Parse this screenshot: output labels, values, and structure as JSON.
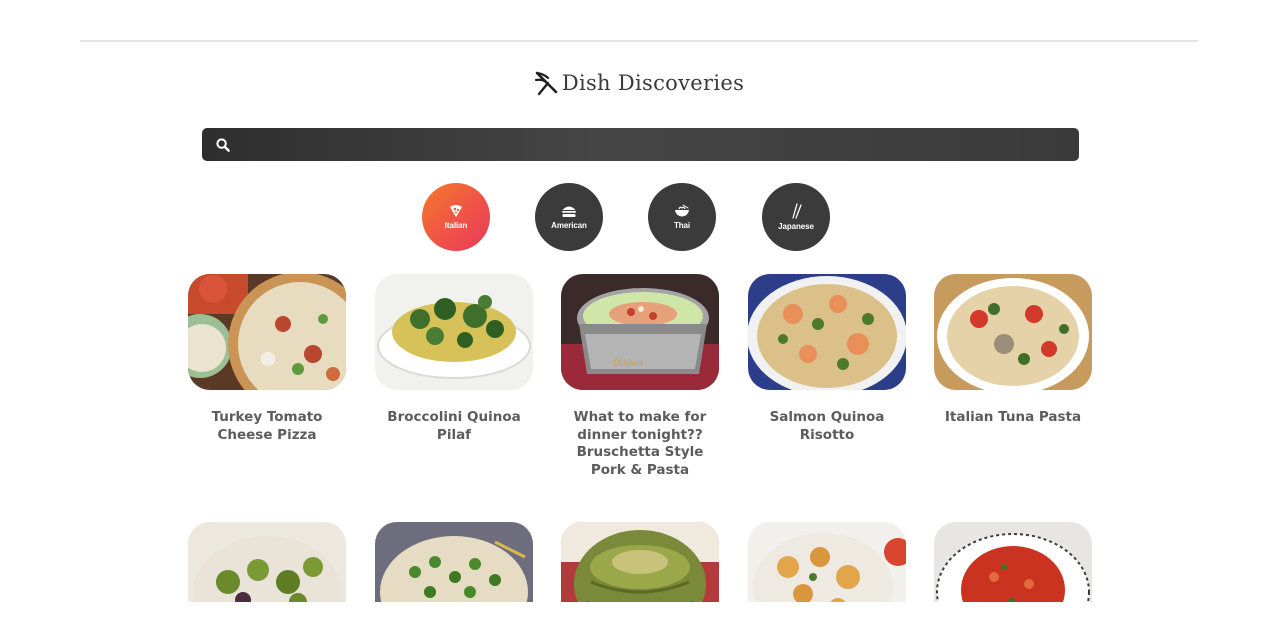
{
  "site": {
    "name": "Dish Discoveries"
  },
  "search": {
    "placeholder": "",
    "value": "",
    "icon": "search-icon"
  },
  "categories": [
    {
      "label": "Italian",
      "icon": "pizza-icon",
      "active": true
    },
    {
      "label": "American",
      "icon": "burger-icon",
      "active": false
    },
    {
      "label": "Thai",
      "icon": "noodle-bowl-icon",
      "active": false
    },
    {
      "label": "Japanese",
      "icon": "chopsticks-icon",
      "active": false
    }
  ],
  "colors": {
    "active_gradient_start": "#f47a2a",
    "active_gradient_end": "#e63b5b",
    "inactive_circle": "#3b3b3b",
    "search_bar": "#3a3a3a",
    "title_text": "#5c5c5c"
  },
  "recipes": [
    {
      "title": "Turkey Tomato Cheese Pizza"
    },
    {
      "title": "Broccolini Quinoa Pilaf"
    },
    {
      "title": "What to make for dinner tonight?? Bruschetta Style Pork & Pasta"
    },
    {
      "title": "Salmon Quinoa Risotto"
    },
    {
      "title": "Italian Tuna Pasta"
    },
    {
      "title": ""
    },
    {
      "title": ""
    },
    {
      "title": ""
    },
    {
      "title": ""
    },
    {
      "title": ""
    }
  ]
}
